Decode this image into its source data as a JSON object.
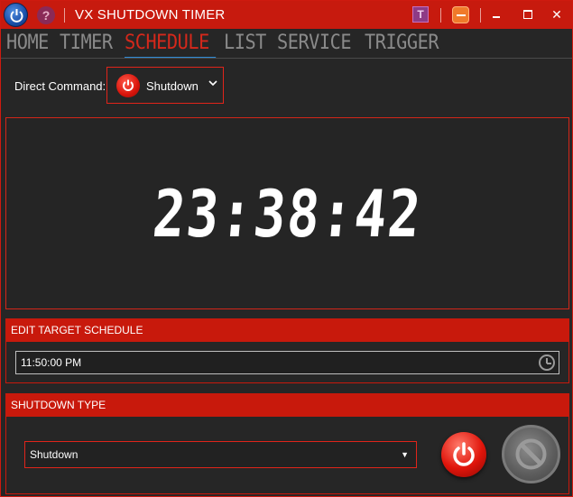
{
  "titlebar": {
    "title": "VX SHUTDOWN TIMER",
    "help_glyph": "?",
    "t_glyph": "T",
    "icons": [
      "power-icon",
      "help-icon",
      "t-icon",
      "minimize-to-tray-icon",
      "minimize-icon",
      "maximize-icon",
      "close-icon"
    ],
    "close_glyph": "✕"
  },
  "menu": {
    "items": [
      "HOME",
      "TIMER",
      "SCHEDULE",
      "LIST",
      "SERVICE",
      "TRIGGER"
    ],
    "active": "SCHEDULE"
  },
  "direct_command": {
    "label": "Direct Command:",
    "value": "Shutdown",
    "chevron": "⌄"
  },
  "clock": {
    "time": "23:38:42"
  },
  "edit_schedule": {
    "header": "EDIT TARGET SCHEDULE",
    "value": "11:50:00 PM"
  },
  "shutdown_type": {
    "header": "SHUTDOWN TYPE",
    "value": "Shutdown",
    "arrow": "▼"
  },
  "colors": {
    "accent": "#c8190c",
    "background": "#262626",
    "active_tab_underline": "#2f8bd6"
  }
}
